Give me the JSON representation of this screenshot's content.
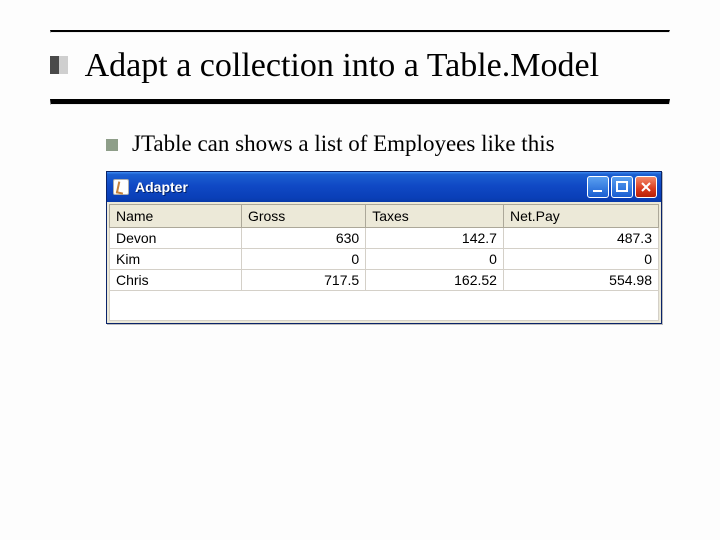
{
  "slide": {
    "title": "Adapt a collection into a Table.Model",
    "bullet": "JTable can shows a list of Employees like this"
  },
  "window": {
    "title": "Adapter"
  },
  "table": {
    "columns": [
      "Name",
      "Gross",
      "Taxes",
      "Net.Pay"
    ],
    "rows": [
      {
        "name": "Devon",
        "gross": "630",
        "taxes": "142.7",
        "net": "487.3"
      },
      {
        "name": "Kim",
        "gross": "0",
        "taxes": "0",
        "net": "0"
      },
      {
        "name": "Chris",
        "gross": "717.5",
        "taxes": "162.52",
        "net": "554.98"
      }
    ]
  }
}
